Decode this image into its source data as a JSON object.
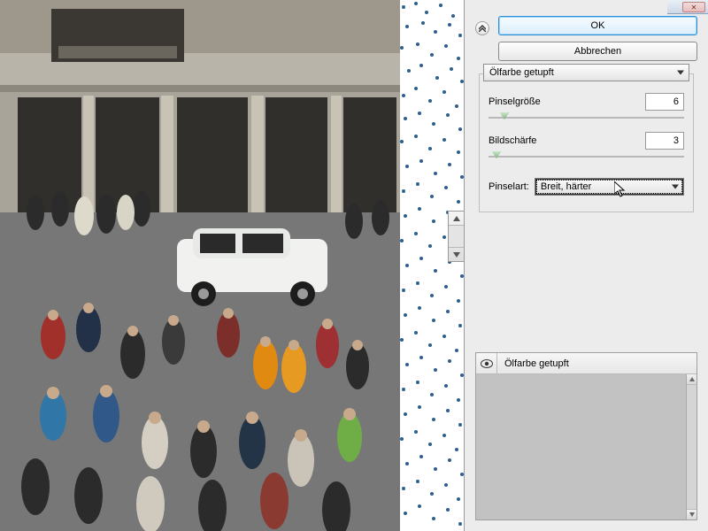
{
  "buttons": {
    "ok": "OK",
    "cancel": "Abbrechen"
  },
  "filter": {
    "name": "Ölfarbe getupft",
    "params": {
      "brush_size": {
        "label": "Pinselgröße",
        "value": "6",
        "slider_pct": 8
      },
      "sharpness": {
        "label": "Bildschärfe",
        "value": "3",
        "slider_pct": 4
      }
    },
    "brush_type": {
      "label": "Pinselart:",
      "value": "Breit, härter"
    }
  },
  "layers": {
    "items": [
      {
        "label": "Ölfarbe getupft"
      }
    ]
  },
  "chart_data": null
}
